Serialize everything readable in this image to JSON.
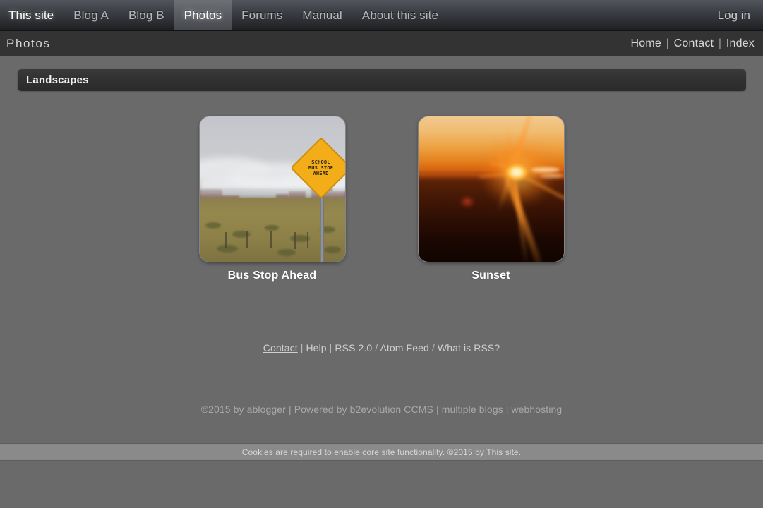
{
  "topnav": {
    "tabs": [
      {
        "label": "This site",
        "active": false,
        "first": true
      },
      {
        "label": "Blog A",
        "active": false
      },
      {
        "label": "Blog B",
        "active": false
      },
      {
        "label": "Photos",
        "active": true
      },
      {
        "label": "Forums",
        "active": false
      },
      {
        "label": "Manual",
        "active": false
      },
      {
        "label": "About this site",
        "active": false
      }
    ],
    "login_label": "Log in"
  },
  "subheader": {
    "title": "Photos",
    "links": [
      {
        "label": "Home"
      },
      {
        "label": "Contact"
      },
      {
        "label": "Index"
      }
    ],
    "separator": "|"
  },
  "section": {
    "title": "Landscapes"
  },
  "gallery": {
    "items": [
      {
        "caption": "Bus Stop Ahead",
        "image": "desert-bus-stop-sign-photo",
        "sign_text": [
          "SCHOOL",
          "BUS STOP",
          "AHEAD"
        ]
      },
      {
        "caption": "Sunset",
        "image": "sunset-over-horizon-photo"
      }
    ]
  },
  "footer": {
    "links": [
      {
        "label": "Contact",
        "hovered": true
      },
      {
        "label": "Help",
        "hovered": false
      },
      {
        "label": "RSS 2.0",
        "hovered": false
      },
      {
        "label": "Atom Feed",
        "hovered": false
      },
      {
        "label": "What is RSS?",
        "hovered": false
      }
    ],
    "sep_pipe": "|",
    "sep_slash": "/",
    "credits": {
      "copyright": "©2015 by ablogger",
      "powered_by": "Powered by b2evolution CCMS",
      "link_blogs": "multiple blogs",
      "link_hosting": "webhosting",
      "separator": "|"
    }
  },
  "cookie_bar": {
    "message": "Cookies are required to enable core site functionality. ©2015 by",
    "link_label": "This site",
    "period": "."
  },
  "colors": {
    "page_bg": "#6a6a6a",
    "nav_top": "#52555b",
    "nav_bottom": "#1b1d20",
    "subheader_bg": "#333333",
    "section_bar_bg": "#303030",
    "cookie_bar_bg": "#8a8a8a",
    "text_light": "#ffffff",
    "text_muted": "#b6b8bb",
    "sign_yellow": "#f2ad18"
  }
}
